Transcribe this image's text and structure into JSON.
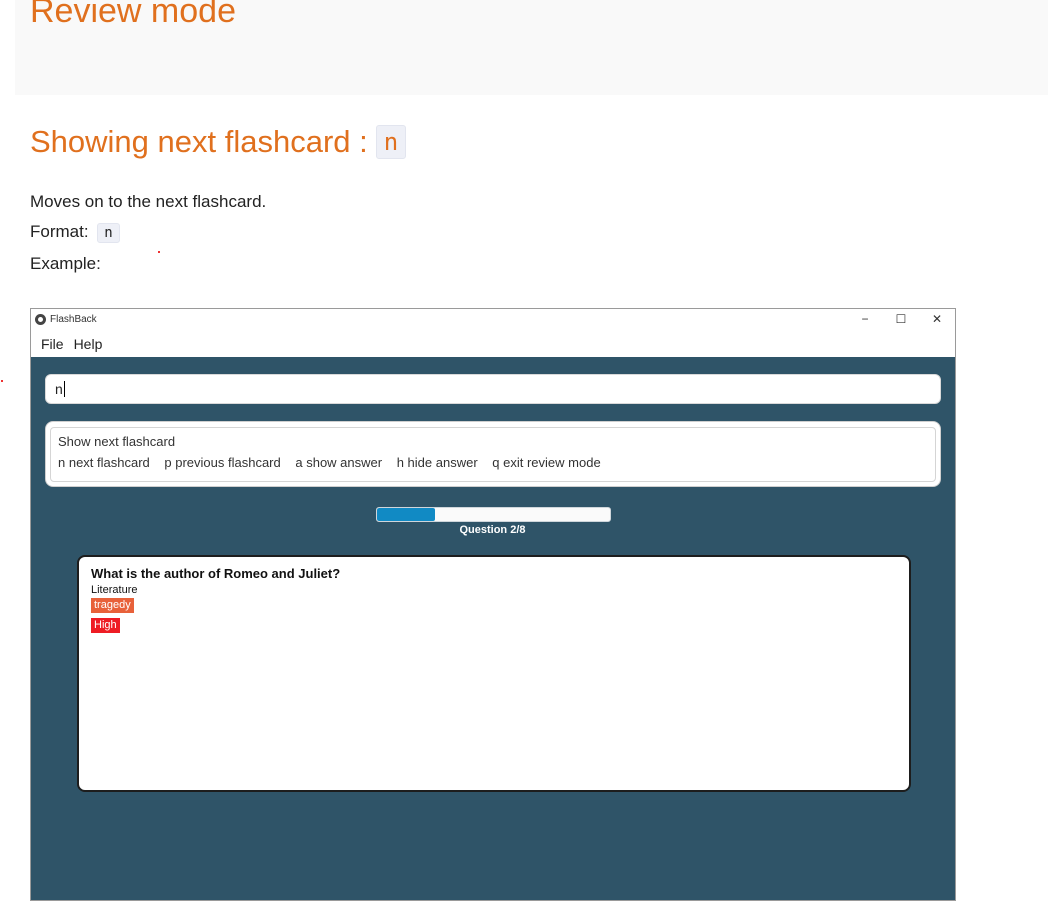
{
  "doc": {
    "section_title": "Review mode",
    "heading": "Showing next flashcard :",
    "heading_code": "n",
    "description": "Moves on to the next flashcard.",
    "format_label": "Format:",
    "format_code": "n",
    "example_label": "Example:"
  },
  "window": {
    "title": "FlashBack",
    "controls": {
      "minimize": "−",
      "maximize": "☐",
      "close": "✕"
    },
    "menu": [
      "File",
      "Help"
    ],
    "command_input": {
      "value": "n"
    },
    "result": {
      "line1": "Show next flashcard",
      "commands": [
        "n next flashcard",
        "p previous flashcard",
        "a show answer",
        "h hide answer",
        "q exit review mode"
      ]
    },
    "progress": {
      "fraction": 0.25,
      "label": "Question 2/8"
    },
    "card": {
      "question": "What is the author of Romeo and Juliet?",
      "category": "Literature",
      "tags": [
        "tragedy"
      ],
      "priority": "High"
    }
  },
  "colors": {
    "heading": "#e0701e",
    "window_bg": "#2f5468",
    "progress_fill": "#118ac4",
    "tag_bg": "#e8613a",
    "priority_bg": "#ee1c24"
  }
}
